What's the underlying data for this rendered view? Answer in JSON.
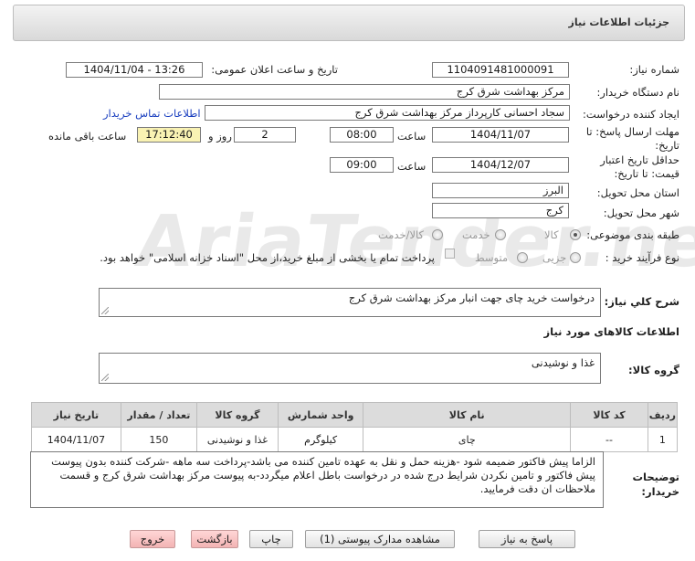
{
  "header": {
    "title": "جزئیات اطلاعات نیاز"
  },
  "fields": {
    "need_number_label": "شماره نیاز:",
    "need_number": "1104091481000091",
    "announce_label": "تاریخ و ساعت اعلان عمومی:",
    "announce_value": "1404/11/04 - 13:26",
    "buyer_org_label": "نام دستگاه خریدار:",
    "buyer_org": "مرکز بهداشت شرق کرج",
    "creator_label": "ایجاد کننده درخواست:",
    "creator": "سجاد احسانی کارپرداز مرکز بهداشت شرق کرج",
    "contact_link": "اطلاعات تماس خریدار",
    "deadline_label": "مهلت ارسال پاسخ: تا تاریخ:",
    "deadline_date": "1404/11/07",
    "time_label": "ساعت",
    "deadline_time": "08:00",
    "days": "2",
    "days_label": "روز و",
    "remaining": "17:12:40",
    "remaining_label": "ساعت باقی مانده",
    "validity_label": "حداقل تاریخ اعتبار قیمت: تا تاریخ:",
    "validity_date": "1404/12/07",
    "validity_time": "09:00",
    "province_label": "استان محل تحویل:",
    "province": "البرز",
    "city_label": "شهر محل تحویل:",
    "city": "کرج",
    "category_label": "طبقه بندی موضوعی:",
    "category_options": [
      "کالا",
      "خدمت",
      "کالا/خدمت"
    ],
    "process_label": "نوع فرآیند خرید :",
    "process_options": [
      "جزیی",
      "متوسط"
    ],
    "payment_note": "پرداخت تمام یا بخشی از مبلغ خرید،از محل \"اسناد خزانه اسلامی\" خواهد بود.",
    "summary_label": "شرح کلي نياز:",
    "summary": "درخواست خرید چای جهت انبار مرکز بهداشت شرق کرج",
    "goods_info_label": "اطلاعات کالاهای مورد نیاز",
    "goods_group_label": "گروه کالا:",
    "goods_group": "غذا و نوشیدنی"
  },
  "table": {
    "headers": [
      "ردیف",
      "کد کالا",
      "نام کالا",
      "واحد شمارش",
      "گروه کالا",
      "تعداد / مقدار",
      "تاریخ نیاز"
    ],
    "rows": [
      [
        "1",
        "--",
        "چای",
        "کیلوگرم",
        "غذا و نوشیدنی",
        "150",
        "1404/11/07"
      ]
    ]
  },
  "notes": {
    "label": "توضیحات خریدار:",
    "text": "الزاما پیش فاکتور ضمیمه شود -هزینه حمل و نقل به عهده تامین کننده می باشد-پرداخت سه ماهه -شرکت کننده بدون پیوست پیش فاکتور و تامین نکردن شرایط درج شده در درخواست باطل اعلام میگردد-به پیوست مرکز بهداشت شرق کرج و قسمت ملاحظات ان دقت فرمایید."
  },
  "buttons": {
    "reply": "پاسخ به نیاز",
    "attachments": "مشاهده مدارک پیوستی (1)",
    "print": "چاپ",
    "back": "بازگشت",
    "exit": "خروج"
  },
  "watermark": "AriaTender.net"
}
